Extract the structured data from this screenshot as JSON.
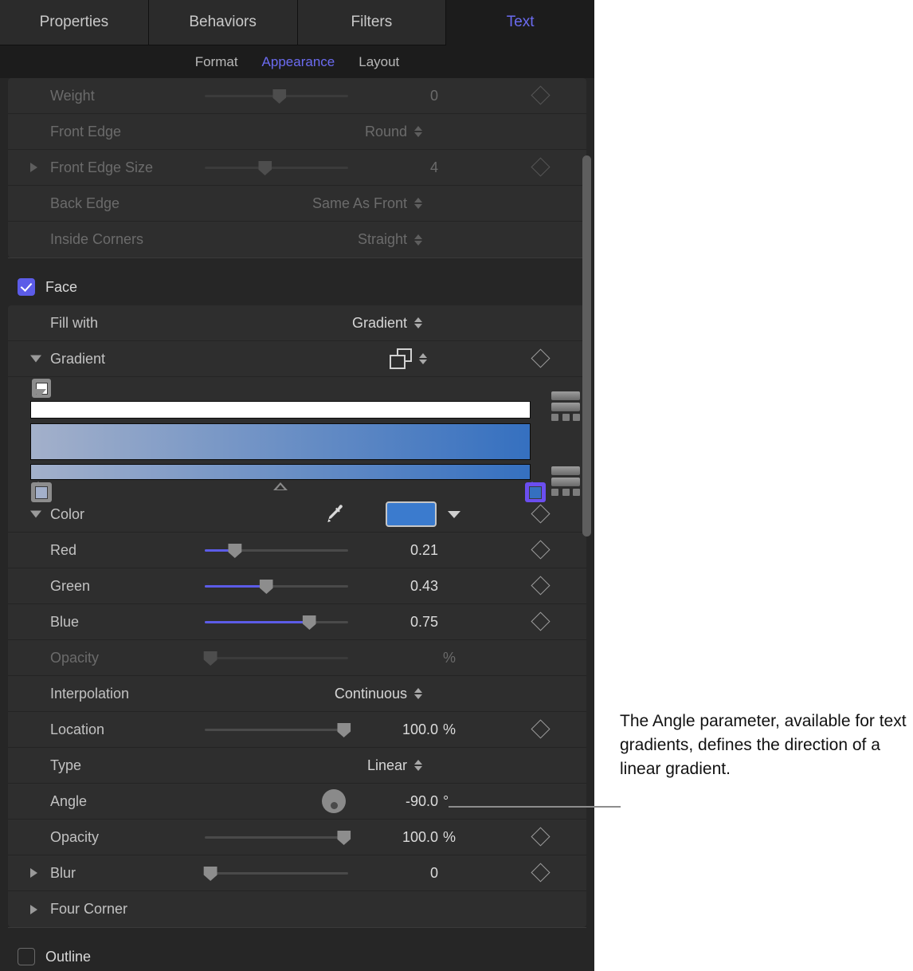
{
  "tabs": [
    {
      "label": "Properties",
      "active": false
    },
    {
      "label": "Behaviors",
      "active": false
    },
    {
      "label": "Filters",
      "active": false
    },
    {
      "label": "Text",
      "active": true
    }
  ],
  "subtabs": [
    {
      "label": "Format",
      "active": false
    },
    {
      "label": "Appearance",
      "active": true
    },
    {
      "label": "Layout",
      "active": false
    }
  ],
  "rows": {
    "weight": {
      "label": "Weight",
      "value": "0"
    },
    "front_edge": {
      "label": "Front Edge",
      "value": "Round"
    },
    "front_edge_size": {
      "label": "Front Edge Size",
      "value": "4"
    },
    "back_edge": {
      "label": "Back Edge",
      "value": "Same As Front"
    },
    "inside_corners": {
      "label": "Inside Corners",
      "value": "Straight"
    },
    "face": {
      "label": "Face",
      "checked": true
    },
    "fill_with": {
      "label": "Fill with",
      "value": "Gradient"
    },
    "gradient": {
      "label": "Gradient"
    },
    "color": {
      "label": "Color"
    },
    "red": {
      "label": "Red",
      "value": "0.21"
    },
    "green": {
      "label": "Green",
      "value": "0.43"
    },
    "blue": {
      "label": "Blue",
      "value": "0.75"
    },
    "grad_opacity": {
      "label": "Opacity",
      "value": "",
      "unit": "%"
    },
    "interpolation": {
      "label": "Interpolation",
      "value": "Continuous"
    },
    "location": {
      "label": "Location",
      "value": "100.0",
      "unit": "%"
    },
    "type": {
      "label": "Type",
      "value": "Linear"
    },
    "angle": {
      "label": "Angle",
      "value": "-90.0",
      "unit": "°"
    },
    "face_opacity": {
      "label": "Opacity",
      "value": "100.0",
      "unit": "%"
    },
    "blur": {
      "label": "Blur",
      "value": "0"
    },
    "four_corner": {
      "label": "Four Corner"
    },
    "outline": {
      "label": "Outline",
      "checked": false
    }
  },
  "gradient_editor": {
    "opacity_stops": [
      {
        "position": 0,
        "color": "#ffffff"
      }
    ],
    "color_stops": [
      {
        "position": 0,
        "color": "#a3b0ca",
        "selected": false
      },
      {
        "position": 100,
        "color": "#3570c0",
        "selected": true
      }
    ],
    "midpoint": 50,
    "bar_gradient_from": "#a3b0ca",
    "bar_gradient_to": "#3570c0"
  },
  "color_swatch": "#3b7bce",
  "accent": "#5c5ce8",
  "annotation": {
    "text": "The Angle parameter, available for text gradients, defines the direction of a linear gradient."
  }
}
